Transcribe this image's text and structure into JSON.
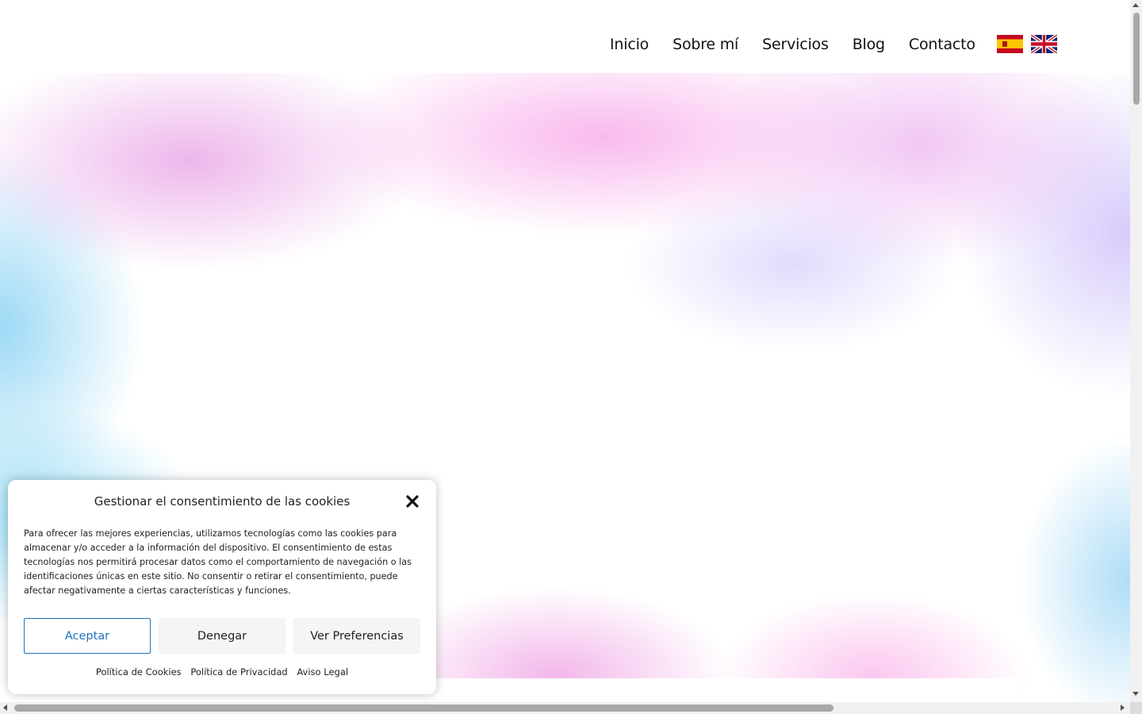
{
  "nav": {
    "items": [
      {
        "label": "Inicio"
      },
      {
        "label": "Sobre mí"
      },
      {
        "label": "Servicios"
      },
      {
        "label": "Blog"
      },
      {
        "label": "Contacto"
      }
    ],
    "languages": [
      {
        "icon": "spain-flag-icon"
      },
      {
        "icon": "uk-flag-icon"
      }
    ]
  },
  "cookie": {
    "title": "Gestionar el consentimiento de las cookies",
    "close_icon": "close-icon",
    "text": "Para ofrecer las mejores experiencias, utilizamos tecnologías como las cookies para almacenar y/o acceder a la información del dispositivo. El consentimiento de estas tecnologías nos permitirá procesar datos como el comportamiento de navegación o las identificaciones únicas en este sitio. No consentir o retirar el consentimiento, puede afectar negativamente a ciertas características y funciones.",
    "accept_label": "Aceptar",
    "deny_label": "Denegar",
    "prefs_label": "Ver Preferencias",
    "links": [
      "Política de Cookies",
      "Política de Privacidad",
      "Aviso Legal"
    ],
    "accent_color": "#1e73be"
  }
}
